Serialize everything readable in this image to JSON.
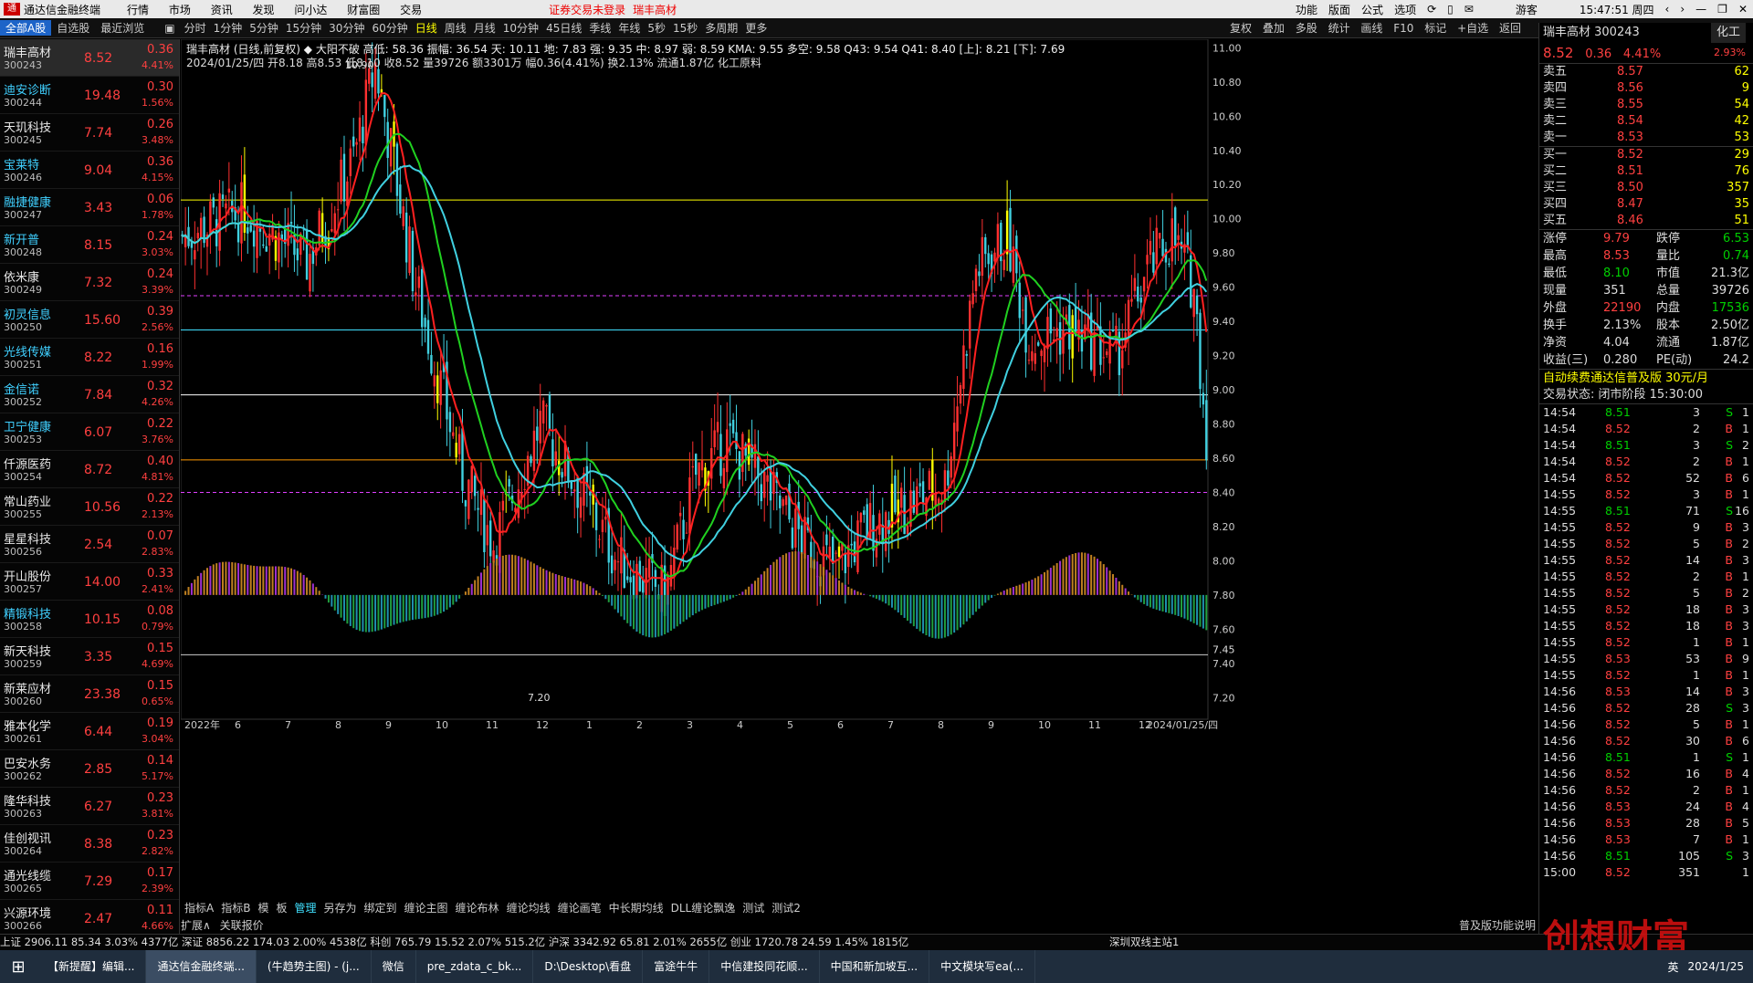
{
  "titlebar": {
    "app_name": "通达信金融终端",
    "menus": [
      "行情",
      "市场",
      "资讯",
      "发现",
      "问小达",
      "财富圈",
      "交易"
    ],
    "notice": "证券交易未登录",
    "stock_name": "瑞丰高材",
    "right_items": [
      "功能",
      "版面",
      "公式",
      "选项"
    ],
    "user": "游客",
    "clock": "15:47:51 周四"
  },
  "toolbar": {
    "tabs": [
      "全部A股",
      "自选股",
      "最近浏览"
    ],
    "periods": [
      "分时",
      "1分钟",
      "5分钟",
      "15分钟",
      "30分钟",
      "60分钟",
      "日线",
      "周线",
      "月线",
      "10分钟",
      "45日线",
      "季线",
      "年线",
      "5秒",
      "15秒",
      "多周期",
      "更多"
    ],
    "active_period": "日线",
    "tools": [
      "复权",
      "叠加",
      "多股",
      "统计",
      "画线",
      "F10",
      "标记",
      "+自选",
      "返回"
    ]
  },
  "stock_list": [
    {
      "name": "瑞丰高材",
      "code": "300243",
      "price": "8.52",
      "change": "0.36",
      "pct": "4.41%"
    },
    {
      "name": "迪安诊断",
      "code": "300244",
      "price": "19.48",
      "change": "0.30",
      "pct": "1.56%"
    },
    {
      "name": "天玑科技",
      "code": "300245",
      "price": "7.74",
      "change": "0.26",
      "pct": "3.48%"
    },
    {
      "name": "宝莱特",
      "code": "300246",
      "price": "9.04",
      "change": "0.36",
      "pct": "4.15%"
    },
    {
      "name": "融捷健康",
      "code": "300247",
      "price": "3.43",
      "change": "0.06",
      "pct": "1.78%"
    },
    {
      "name": "新开普",
      "code": "300248",
      "price": "8.15",
      "change": "0.24",
      "pct": "3.03%"
    },
    {
      "name": "依米康",
      "code": "300249",
      "price": "7.32",
      "change": "0.24",
      "pct": "3.39%"
    },
    {
      "name": "初灵信息",
      "code": "300250",
      "price": "15.60",
      "change": "0.39",
      "pct": "2.56%"
    },
    {
      "name": "光线传媒",
      "code": "300251",
      "price": "8.22",
      "change": "0.16",
      "pct": "1.99%"
    },
    {
      "name": "金信诺",
      "code": "300252",
      "price": "7.84",
      "change": "0.32",
      "pct": "4.26%"
    },
    {
      "name": "卫宁健康",
      "code": "300253",
      "price": "6.07",
      "change": "0.22",
      "pct": "3.76%"
    },
    {
      "name": "仟源医药",
      "code": "300254",
      "price": "8.72",
      "change": "0.40",
      "pct": "4.81%"
    },
    {
      "name": "常山药业",
      "code": "300255",
      "price": "10.56",
      "change": "0.22",
      "pct": "2.13%"
    },
    {
      "name": "星星科技",
      "code": "300256",
      "price": "2.54",
      "change": "0.07",
      "pct": "2.83%"
    },
    {
      "name": "开山股份",
      "code": "300257",
      "price": "14.00",
      "change": "0.33",
      "pct": "2.41%"
    },
    {
      "name": "精锻科技",
      "code": "300258",
      "price": "10.15",
      "change": "0.08",
      "pct": "0.79%"
    },
    {
      "name": "新天科技",
      "code": "300259",
      "price": "3.35",
      "change": "0.15",
      "pct": "4.69%"
    },
    {
      "name": "新莱应材",
      "code": "300260",
      "price": "23.38",
      "change": "0.15",
      "pct": "0.65%"
    },
    {
      "name": "雅本化学",
      "code": "300261",
      "price": "6.44",
      "change": "0.19",
      "pct": "3.04%"
    },
    {
      "name": "巴安水务",
      "code": "300262",
      "price": "2.85",
      "change": "0.14",
      "pct": "5.17%"
    },
    {
      "name": "隆华科技",
      "code": "300263",
      "price": "6.27",
      "change": "0.23",
      "pct": "3.81%"
    },
    {
      "name": "佳创视讯",
      "code": "300264",
      "price": "8.38",
      "change": "0.23",
      "pct": "2.82%"
    },
    {
      "name": "通光线缆",
      "code": "300265",
      "price": "7.29",
      "change": "0.17",
      "pct": "2.39%"
    },
    {
      "name": "兴源环境",
      "code": "300266",
      "price": "2.47",
      "change": "0.11",
      "pct": "4.66%"
    }
  ],
  "chart_header": {
    "line1": "瑞丰高材 (日线,前复权) ◆ 大阳不破 高低: 58.36 振幅: 36.54 天: 10.11 地: 7.83 强: 9.35 中: 8.97 弱: 8.59 KMA: 9.55 多空: 9.58 Q43: 9.54 Q41: 8.40 [上]: 8.21 [下]: 7.69",
    "line2": "2024/01/25/四 开8.18 高8.53 低8.10 收8.52 量39726 额3301万 幅0.36(4.41%) 换2.13% 流通1.87亿 化工原料"
  },
  "chart_data": {
    "type": "candlestick",
    "title": "瑞丰高材 (日线,前复权)",
    "y_axis_ticks": [
      "11.00",
      "10.80",
      "10.60",
      "10.40",
      "10.20",
      "10.00",
      "9.80",
      "9.60",
      "9.40",
      "9.20",
      "9.00",
      "8.80",
      "8.60",
      "8.40",
      "8.20",
      "8.00",
      "7.80",
      "7.60",
      "7.40",
      "7.20"
    ],
    "ylim": [
      7.1,
      11.05
    ],
    "x_axis_labels": [
      "2022年",
      "6",
      "7",
      "8",
      "9",
      "10",
      "11",
      "12",
      "1",
      "2",
      "3",
      "4",
      "5",
      "6",
      "7",
      "8",
      "9",
      "10",
      "11",
      "12",
      "2024/01/25/四"
    ],
    "annotations": {
      "high_label": "10.90",
      "low_label": "7.20",
      "current_price_tag": "7.45"
    },
    "horizontal_levels": {
      "天": 10.11,
      "强": 9.35,
      "中": 8.97,
      "弱": 8.59,
      "Q41": 8.4,
      "KMA": 9.55
    },
    "last_bar": {
      "date": "2024/01/25",
      "open": 8.18,
      "high": 8.53,
      "low": 8.1,
      "close": 8.52,
      "volume": 39726
    }
  },
  "indicator_tabs": [
    "指标A",
    "指标B",
    "模",
    "板",
    "管理",
    "另存为",
    "绑定到",
    "缠论主图",
    "缠论布林",
    "缠论均线",
    "缠论画笔",
    "中长期均线",
    "DLL缠论飘逸",
    "测试",
    "测试2"
  ],
  "indicator_tabs_row2": [
    "扩展∧",
    "关联报价"
  ],
  "right_panel": {
    "title": "瑞丰高材 300243",
    "tag": "化工",
    "price": "8.52",
    "change": "0.36",
    "pct": "4.41%",
    "pct2": "2.93%",
    "sell_levels": [
      {
        "label": "卖五",
        "price": "8.57",
        "vol": "62"
      },
      {
        "label": "卖四",
        "price": "8.56",
        "vol": "9"
      },
      {
        "label": "卖三",
        "price": "8.55",
        "vol": "54"
      },
      {
        "label": "卖二",
        "price": "8.54",
        "vol": "42"
      },
      {
        "label": "卖一",
        "price": "8.53",
        "vol": "53"
      }
    ],
    "buy_levels": [
      {
        "label": "买一",
        "price": "8.52",
        "vol": "29"
      },
      {
        "label": "买二",
        "price": "8.51",
        "vol": "76"
      },
      {
        "label": "买三",
        "price": "8.50",
        "vol": "357"
      },
      {
        "label": "买四",
        "price": "8.47",
        "vol": "35"
      },
      {
        "label": "买五",
        "price": "8.46",
        "vol": "51"
      }
    ],
    "stats": [
      {
        "k1": "涨停",
        "v1": "9.79",
        "k2": "跌停",
        "v2": "6.53"
      },
      {
        "k1": "最高",
        "v1": "8.53",
        "k2": "量比",
        "v2": "0.74"
      },
      {
        "k1": "最低",
        "v1": "8.10",
        "k2": "市值",
        "v2": "21.3亿"
      },
      {
        "k1": "现量",
        "v1": "351",
        "k2": "总量",
        "v2": "39726"
      },
      {
        "k1": "外盘",
        "v1": "22190",
        "k2": "内盘",
        "v2": "17536"
      },
      {
        "k1": "换手",
        "v1": "2.13%",
        "k2": "股本",
        "v2": "2.50亿"
      },
      {
        "k1": "净资",
        "v1": "4.04",
        "k2": "流通",
        "v2": "1.87亿"
      },
      {
        "k1": "收益(三)",
        "v1": "0.280",
        "k2": "PE(动)",
        "v2": "24.2"
      }
    ],
    "promo": "自动续费通达信普及版 30元/月",
    "status": "交易状态: 闭市阶段 15:30:00",
    "ticks": [
      {
        "t": "14:54",
        "p": "8.51",
        "v": "3",
        "s": "S",
        "n": "1"
      },
      {
        "t": "14:54",
        "p": "8.52",
        "v": "2",
        "s": "B",
        "n": "1"
      },
      {
        "t": "14:54",
        "p": "8.51",
        "v": "3",
        "s": "S",
        "n": "2"
      },
      {
        "t": "14:54",
        "p": "8.52",
        "v": "2",
        "s": "B",
        "n": "1"
      },
      {
        "t": "14:54",
        "p": "8.52",
        "v": "52",
        "s": "B",
        "n": "6"
      },
      {
        "t": "14:55",
        "p": "8.52",
        "v": "3",
        "s": "B",
        "n": "1"
      },
      {
        "t": "14:55",
        "p": "8.51",
        "v": "71",
        "s": "S",
        "n": "16"
      },
      {
        "t": "14:55",
        "p": "8.52",
        "v": "9",
        "s": "B",
        "n": "3"
      },
      {
        "t": "14:55",
        "p": "8.52",
        "v": "5",
        "s": "B",
        "n": "2"
      },
      {
        "t": "14:55",
        "p": "8.52",
        "v": "14",
        "s": "B",
        "n": "3"
      },
      {
        "t": "14:55",
        "p": "8.52",
        "v": "2",
        "s": "B",
        "n": "1"
      },
      {
        "t": "14:55",
        "p": "8.52",
        "v": "5",
        "s": "B",
        "n": "2"
      },
      {
        "t": "14:55",
        "p": "8.52",
        "v": "18",
        "s": "B",
        "n": "3"
      },
      {
        "t": "14:55",
        "p": "8.52",
        "v": "18",
        "s": "B",
        "n": "3"
      },
      {
        "t": "14:55",
        "p": "8.52",
        "v": "1",
        "s": "B",
        "n": "1"
      },
      {
        "t": "14:55",
        "p": "8.53",
        "v": "53",
        "s": "B",
        "n": "9"
      },
      {
        "t": "14:55",
        "p": "8.52",
        "v": "1",
        "s": "B",
        "n": "1"
      },
      {
        "t": "14:56",
        "p": "8.53",
        "v": "14",
        "s": "B",
        "n": "3"
      },
      {
        "t": "14:56",
        "p": "8.52",
        "v": "28",
        "s": "S",
        "n": "3"
      },
      {
        "t": "14:56",
        "p": "8.52",
        "v": "5",
        "s": "B",
        "n": "1"
      },
      {
        "t": "14:56",
        "p": "8.52",
        "v": "30",
        "s": "B",
        "n": "6"
      },
      {
        "t": "14:56",
        "p": "8.51",
        "v": "1",
        "s": "S",
        "n": "1"
      },
      {
        "t": "14:56",
        "p": "8.52",
        "v": "16",
        "s": "B",
        "n": "4"
      },
      {
        "t": "14:56",
        "p": "8.52",
        "v": "2",
        "s": "B",
        "n": "1"
      },
      {
        "t": "14:56",
        "p": "8.53",
        "v": "24",
        "s": "B",
        "n": "4"
      },
      {
        "t": "14:56",
        "p": "8.53",
        "v": "28",
        "s": "B",
        "n": "5"
      },
      {
        "t": "14:56",
        "p": "8.53",
        "v": "7",
        "s": "B",
        "n": "1"
      },
      {
        "t": "14:56",
        "p": "8.51",
        "v": "105",
        "s": "S",
        "n": "3"
      },
      {
        "t": "15:00",
        "p": "8.52",
        "v": "351",
        "s": "",
        "n": "1"
      }
    ]
  },
  "bottom_bar": {
    "text": "上证 2906.11 85.34 3.03% 4377亿  深证 8856.22 174.03 2.00% 4538亿  科创 765.79 15.52 2.07% 515.2亿  沪深 3342.92 65.81 2.01% 2655亿  创业 1720.78 24.59 1.45% 1815亿",
    "right_text": "深圳双线主站1",
    "feature_note": "普及版功能说明"
  },
  "taskbar": {
    "tasks": [
      "【新提醒】编辑...",
      "通达信金融终端...",
      "(牛趋势主图) - (j...",
      "微信",
      "pre_zdata_c_bk...",
      "D:\\Desktop\\看盘",
      "富途牛牛",
      "中信建投同花顺...",
      "中国和新加坡互...",
      "中文模块写ea(..."
    ],
    "active": "通达信金融终端...",
    "date": "2024/1/25",
    "lang": "英"
  },
  "watermark": "创想财富",
  "colors": {
    "up": "#ff4040",
    "down": "#40e0ff",
    "yellow": "#ffff00",
    "ma_red": "#ff2020",
    "ma_green": "#20d020",
    "ma_cyan": "#40d0e0"
  }
}
